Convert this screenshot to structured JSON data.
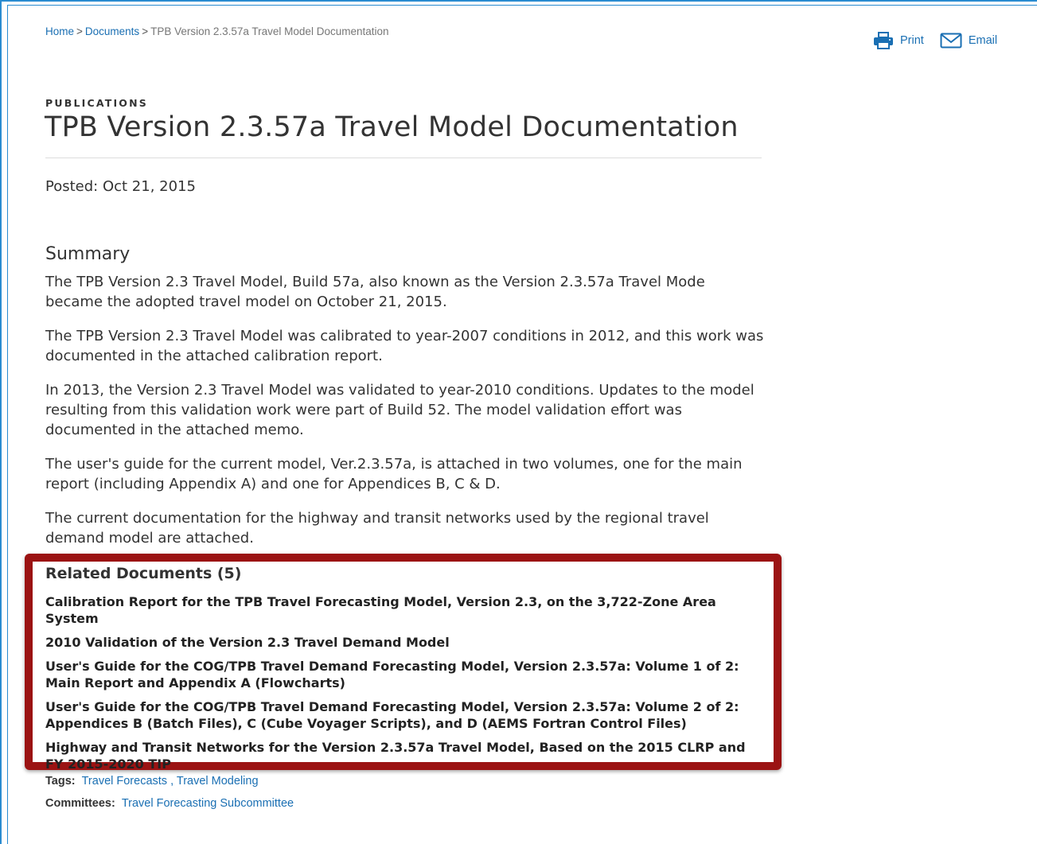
{
  "breadcrumb": {
    "home": "Home",
    "documents": "Documents",
    "current": "TPB Version 2.3.57a Travel Model Documentation",
    "separator": ">"
  },
  "tools": {
    "print_label": "Print",
    "email_label": "Email"
  },
  "header": {
    "kicker": "PUBLICATIONS",
    "title": "TPB Version 2.3.57a Travel Model Documentation",
    "posted": "Posted: Oct 21, 2015"
  },
  "summary": {
    "heading": "Summary",
    "paragraphs": [
      "The TPB Version 2.3 Travel Model, Build 57a, also known as the Version 2.3.57a Travel Mode became the adopted travel model on October 21, 2015.",
      "The TPB Version 2.3 Travel Model was calibrated to year-2007 conditions in 2012, and this work was documented in the attached calibration report.",
      "In 2013, the Version 2.3 Travel Model was validated to year-2010 conditions. Updates to the model resulting from this validation work were part of Build 52. The model validation effort was documented in the attached memo.",
      "The user's guide for the current model, Ver.2.3.57a, is attached in two volumes, one for the main report (including Appendix A) and one for Appendices B, C & D.",
      "The current documentation for the highway and transit networks used by the regional travel demand model are attached."
    ]
  },
  "related": {
    "heading": "Related Documents (5)",
    "items": [
      "Calibration Report for the TPB Travel Forecasting Model, Version 2.3, on the 3,722-Zone Area System",
      "2010 Validation of the Version 2.3 Travel Demand Model",
      "User's Guide for the COG/TPB Travel Demand Forecasting Model, Version 2.3.57a: Volume 1 of 2: Main Report and Appendix A (Flowcharts)",
      "User's Guide for the COG/TPB Travel Demand Forecasting Model, Version 2.3.57a: Volume 2 of 2: Appendices B (Batch Files), C (Cube Voyager Scripts), and D (AEMS Fortran Control Files)",
      "Highway and Transit Networks for the Version 2.3.57a Travel Model, Based on the 2015 CLRP and FY 2015-2020 TIP"
    ]
  },
  "meta": {
    "tags_label": "Tags:",
    "tags": [
      "Travel Forecasts",
      "Travel Modeling"
    ],
    "tag_separator": ",",
    "committees_label": "Committees:",
    "committees": [
      "Travel Forecasting Subcommittee"
    ]
  },
  "colors": {
    "link": "#1a6fb3",
    "highlight_border": "#9b1313",
    "frame": "#2a8bd0",
    "text": "#333333"
  },
  "icons": {
    "print": "printer-icon",
    "email": "envelope-icon"
  }
}
